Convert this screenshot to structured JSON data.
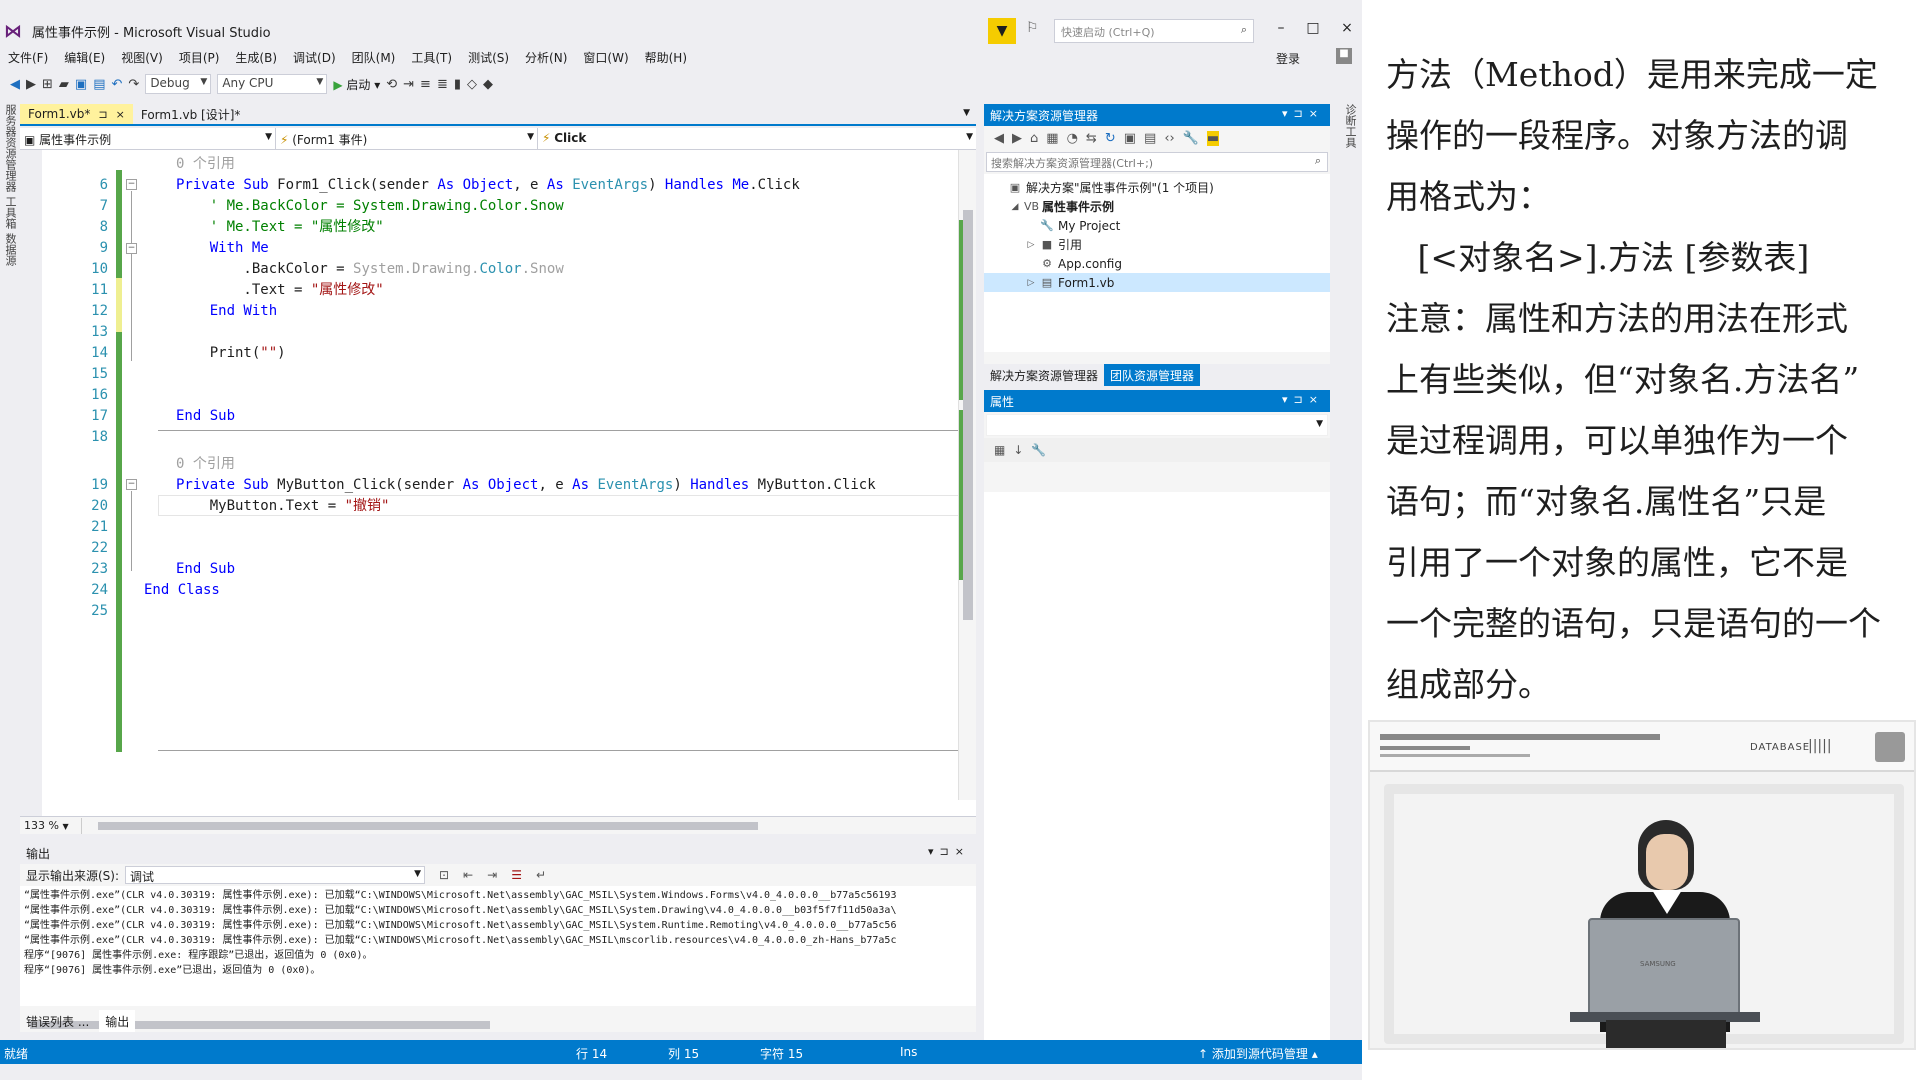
{
  "window": {
    "title": "属性事件示例 - Microsoft Visual Studio",
    "quick_launch_placeholder": "快速启动 (Ctrl+Q)",
    "login": "登录",
    "minimize": "–",
    "maximize": "□",
    "close": "×"
  },
  "menu": [
    "文件(F)",
    "编辑(E)",
    "视图(V)",
    "项目(P)",
    "生成(B)",
    "调试(D)",
    "团队(M)",
    "工具(T)",
    "测试(S)",
    "分析(N)",
    "窗口(W)",
    "帮助(H)"
  ],
  "toolbar": {
    "config": "Debug",
    "platform": "Any CPU",
    "start": "启动"
  },
  "left_strip": [
    "服务器资源管理器",
    "工具箱",
    "数据源"
  ],
  "right_strip": [
    "诊断工具"
  ],
  "doc_tabs": {
    "active": "Form1.vb*",
    "active_pin": "⊐",
    "active_close": "×",
    "inactive": "Form1.vb [设计]*"
  },
  "nav": {
    "project": "属性事件示例",
    "object": "(Form1 事件)",
    "member": "Click"
  },
  "code": {
    "ref_hint_1": "0 个引用",
    "ref_hint_2": "0 个引用",
    "lines": [
      {
        "n": "6",
        "seg": [
          [
            "kw",
            "Private Sub "
          ],
          [
            "",
            "Form1_Click("
          ],
          [
            "",
            "sender "
          ],
          [
            "kw",
            "As Object"
          ],
          [
            "",
            ", e "
          ],
          [
            "kw",
            "As "
          ],
          [
            "ty",
            "EventArgs"
          ],
          [
            "",
            ") "
          ],
          [
            "kw",
            "Handles Me"
          ],
          [
            "",
            ".Click"
          ]
        ]
      },
      {
        "n": "7",
        "seg": [
          [
            "cm",
            "    ' Me.BackColor = System.Drawing.Color.Snow"
          ]
        ]
      },
      {
        "n": "8",
        "seg": [
          [
            "cm",
            "    ' Me.Text = \"属性修改\""
          ]
        ]
      },
      {
        "n": "9",
        "seg": [
          [
            "kw",
            "    With Me"
          ]
        ]
      },
      {
        "n": "10",
        "seg": [
          [
            "",
            "        .BackColor = "
          ],
          [
            "gray",
            "System.Drawing."
          ],
          [
            "ty",
            "Color"
          ],
          [
            "gray",
            ".Snow"
          ]
        ]
      },
      {
        "n": "11",
        "seg": [
          [
            "",
            "        .Text = "
          ],
          [
            "str",
            "\"属性修改\""
          ]
        ]
      },
      {
        "n": "12",
        "seg": [
          [
            "kw",
            "    End With"
          ]
        ]
      },
      {
        "n": "13",
        "seg": [
          [
            "",
            ""
          ]
        ]
      },
      {
        "n": "14",
        "seg": [
          [
            "",
            "    Print("
          ],
          [
            "str",
            "\"\""
          ],
          [
            "",
            ")"
          ]
        ]
      },
      {
        "n": "15",
        "seg": [
          [
            "",
            ""
          ]
        ]
      },
      {
        "n": "16",
        "seg": [
          [
            "",
            ""
          ]
        ]
      },
      {
        "n": "17",
        "seg": [
          [
            "kw",
            "End Sub"
          ]
        ]
      },
      {
        "n": "18",
        "seg": [
          [
            "",
            ""
          ]
        ]
      },
      {
        "n": "19",
        "seg": [
          [
            "kw",
            "Private Sub "
          ],
          [
            "",
            "MyButton_Click(sender "
          ],
          [
            "kw",
            "As Object"
          ],
          [
            "",
            ", e "
          ],
          [
            "kw",
            "As "
          ],
          [
            "ty",
            "EventArgs"
          ],
          [
            "",
            ") "
          ],
          [
            "kw",
            "Handles "
          ],
          [
            "",
            "MyButton.Click"
          ]
        ]
      },
      {
        "n": "20",
        "seg": [
          [
            "",
            "    MyButton.Text = "
          ],
          [
            "str",
            "\"撤销\""
          ]
        ]
      },
      {
        "n": "21",
        "seg": [
          [
            "",
            ""
          ]
        ]
      },
      {
        "n": "22",
        "seg": [
          [
            "",
            ""
          ]
        ]
      },
      {
        "n": "23",
        "seg": [
          [
            "kw",
            "End Sub"
          ]
        ]
      },
      {
        "n": "24",
        "seg": [
          [
            "kw",
            "End Class"
          ]
        ]
      },
      {
        "n": "25",
        "seg": [
          [
            "",
            ""
          ]
        ]
      }
    ]
  },
  "zoom": "133 %",
  "solution_explorer": {
    "title": "解决方案资源管理器",
    "search_placeholder": "搜索解决方案资源管理器(Ctrl+;)",
    "tree": [
      {
        "label": "解决方案\"属性事件示例\"(1 个项目)",
        "indent": 0,
        "expand": "",
        "icon": "▣"
      },
      {
        "label": "属性事件示例",
        "indent": 1,
        "expand": "◢",
        "icon": "VB"
      },
      {
        "label": "My Project",
        "indent": 2,
        "expand": "",
        "icon": "🔧"
      },
      {
        "label": "引用",
        "indent": 2,
        "expand": "▷",
        "icon": "■"
      },
      {
        "label": "App.config",
        "indent": 2,
        "expand": "",
        "icon": "⚙"
      },
      {
        "label": "Form1.vb",
        "indent": 2,
        "expand": "▷",
        "icon": "▤"
      }
    ],
    "tab_active": "解决方案资源管理器",
    "tab_inactive": "团队资源管理器"
  },
  "properties": {
    "title": "属性"
  },
  "output": {
    "title": "输出",
    "source_label": "显示输出来源(S):",
    "source_value": "调试",
    "lines": [
      "“属性事件示例.exe”(CLR v4.0.30319: 属性事件示例.exe): 已加载“C:\\WINDOWS\\Microsoft.Net\\assembly\\GAC_MSIL\\System.Windows.Forms\\v4.0_4.0.0.0__b77a5c56193",
      "“属性事件示例.exe”(CLR v4.0.30319: 属性事件示例.exe): 已加载“C:\\WINDOWS\\Microsoft.Net\\assembly\\GAC_MSIL\\System.Drawing\\v4.0_4.0.0.0__b03f5f7f11d50a3a\\",
      "“属性事件示例.exe”(CLR v4.0.30319: 属性事件示例.exe): 已加载“C:\\WINDOWS\\Microsoft.Net\\assembly\\GAC_MSIL\\System.Runtime.Remoting\\v4.0_4.0.0.0__b77a5c56",
      "“属性事件示例.exe”(CLR v4.0.30319: 属性事件示例.exe): 已加载“C:\\WINDOWS\\Microsoft.Net\\assembly\\GAC_MSIL\\mscorlib.resources\\v4.0_4.0.0.0_zh-Hans_b77a5c",
      "程序“[9076] 属性事件示例.exe: 程序跟踪”已退出，返回值为 0 (0x0)。",
      "程序“[9076] 属性事件示例.exe”已退出，返回值为 0 (0x0)。"
    ],
    "tab_errors": "错误列表 ...",
    "tab_output": "输出"
  },
  "status": {
    "ready": "就绪",
    "row": "行 14",
    "col": "列 15",
    "char": "字符 15",
    "mode": "Ins",
    "source_control": "添加到源代码管理"
  },
  "lecture": {
    "lines": [
      "方法（Method）是用来完成一定",
      "操作的一段程序。对象方法的调",
      "用格式为：",
      "   [<对象名>].方法 [参数表]",
      "注意：属性和方法的用法在形式",
      "上有些类似，但“对象名.方法名”",
      "是过程调用，可以单独作为一个",
      "语句；而“对象名.属性名”只是",
      "引用了一个对象的属性，它不是",
      "一个完整的语句，只是语句的一个",
      "组成部分。"
    ]
  },
  "video": {
    "label": "DATABASE",
    "laptop_brand": "SAMSUNG"
  },
  "colors": {
    "accent": "#007acc",
    "keyword": "#0000ff",
    "type": "#2b91af",
    "string": "#a31515",
    "comment": "#008000",
    "active_tab": "#fff29d"
  }
}
